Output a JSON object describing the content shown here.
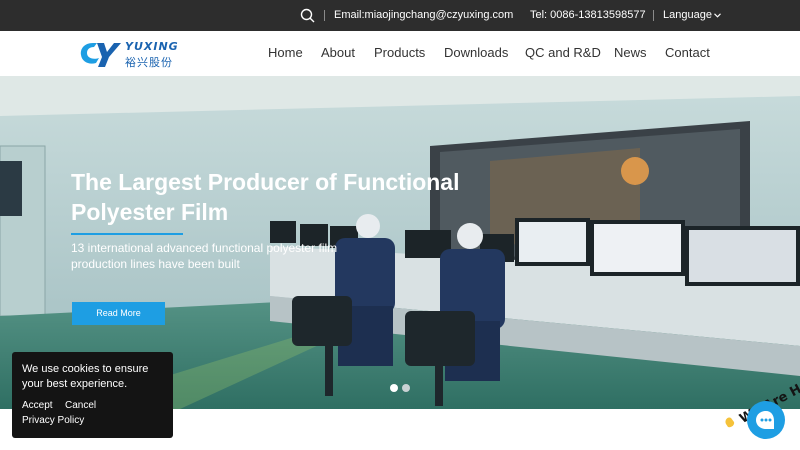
{
  "topbar": {
    "email": "Email:miaojingchang@czyuxing.com",
    "tel": "Tel:  0086-13813598577",
    "language": "Language"
  },
  "logo": {
    "name_en": "YUXING",
    "name_cn": "裕兴股份"
  },
  "nav": {
    "items": [
      {
        "label": "Home"
      },
      {
        "label": "About"
      },
      {
        "label": "Products"
      },
      {
        "label": "Downloads"
      },
      {
        "label": "QC and R&D"
      },
      {
        "label": "News"
      },
      {
        "label": "Contact"
      }
    ]
  },
  "hero": {
    "title": "The Largest Producer of Functional Polyester Film",
    "subtitle": "13 international advanced functional polyester film production lines have been built",
    "cta_label": "Read More",
    "slides": 2,
    "active_slide": 1
  },
  "cookie": {
    "message": "We use cookies to ensure your best experience.",
    "accept_label": "Accept",
    "cancel_label": "Cancel",
    "privacy_label": "Privacy Policy"
  },
  "chat": {
    "label": "We Are Here!"
  },
  "colors": {
    "accent": "#1e9ee3",
    "topbar": "#2d2d2d",
    "logo": "#1a63b0"
  }
}
